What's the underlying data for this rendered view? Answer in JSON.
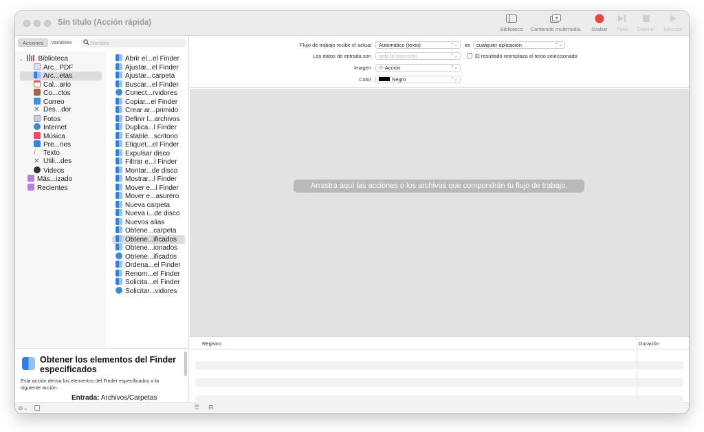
{
  "window": {
    "title": "Sin título (Acción rápida)"
  },
  "toolbar": {
    "biblioteca": "Biblioteca",
    "multimedia": "Contenido multimedia",
    "grabar": "Grabar",
    "paso": "Paso",
    "detener": "Detener",
    "ejecutar": "Ejecutar",
    "record_color": "#e8463c"
  },
  "left_tabs": {
    "acciones": "Acciones",
    "variables": "Variables",
    "search_placeholder": "Nombre"
  },
  "library": [
    {
      "label": "Biblioteca",
      "icon": "library-icon"
    },
    {
      "label": "Arc...PDF",
      "icon": "pdf-icon"
    },
    {
      "label": "Arc...etas",
      "icon": "finder-icon"
    },
    {
      "label": "Cal...ario",
      "icon": "calendar-icon"
    },
    {
      "label": "Co...ctos",
      "icon": "contacts-icon"
    },
    {
      "label": "Correo",
      "icon": "mail-icon"
    },
    {
      "label": "Des...dor",
      "icon": "tools-icon"
    },
    {
      "label": "Fotos",
      "icon": "photos-icon"
    },
    {
      "label": "Internet",
      "icon": "globe-icon"
    },
    {
      "label": "Música",
      "icon": "music-icon"
    },
    {
      "label": "Pre...nes",
      "icon": "presentation-icon"
    },
    {
      "label": "Texto",
      "icon": "text-icon"
    },
    {
      "label": "Utili...des",
      "icon": "utilities-icon"
    },
    {
      "label": "Videos",
      "icon": "video-icon"
    },
    {
      "label": "Más...izado",
      "icon": "folder-icon"
    },
    {
      "label": "Recientes",
      "icon": "folder-icon"
    }
  ],
  "actions": [
    "Abrir el...el Finder",
    "Ajustar...el Finder",
    "Ajustar...carpeta",
    "Buscar...el Finder",
    "Conect...rvidores",
    "Copiar...el Finder",
    "Crear ar...primido",
    "Definir l...archivos",
    "Duplica...l Finder",
    "Establе...scritorio",
    "Etiquet...el Finder",
    "Expulsar disco",
    "Filtrar e...l Finder",
    "Montar...de disco",
    "Mostrar...l Finder",
    "Mover e...l Finder",
    "Mover e...asurero",
    "Nueva carpeta",
    "Nueva i...de disco",
    "Nuevos alias",
    "Obtene...carpeta",
    "Obtene...ificados",
    "Obtene...ionados",
    "Obtene...ificados",
    "Ordena...el Finder",
    "Renom...el Finder",
    "Solicita...el Finder",
    "Solicitar...vidores"
  ],
  "description": {
    "title": "Obtener los elementos del Finder especificados",
    "text": "Esta acción deriva los elementos del Finder especificados a la siguiente acción.",
    "input_label": "Entrada:",
    "input_value": "Archivos/Carpetas"
  },
  "form": {
    "flujo_label": "Flujo de trabajo recibe el actual",
    "flujo_value": "Automático (texto)",
    "en_label": "en",
    "app_value": "cualquier aplicación",
    "datos_label": "Los datos de entrada son",
    "datos_value": "toda la selección",
    "reemplaza_label": "El resultado reemplaza el texto seleccionado",
    "imagen_label": "Imagen",
    "imagen_value": "Acción",
    "color_label": "Color",
    "color_value": "Negro"
  },
  "workflow": {
    "hint": "Arrastra aquí las acciones o los archivos que compondrán tu flujo de trabajo."
  },
  "log": {
    "registro": "Registro",
    "duracion": "Duración"
  }
}
